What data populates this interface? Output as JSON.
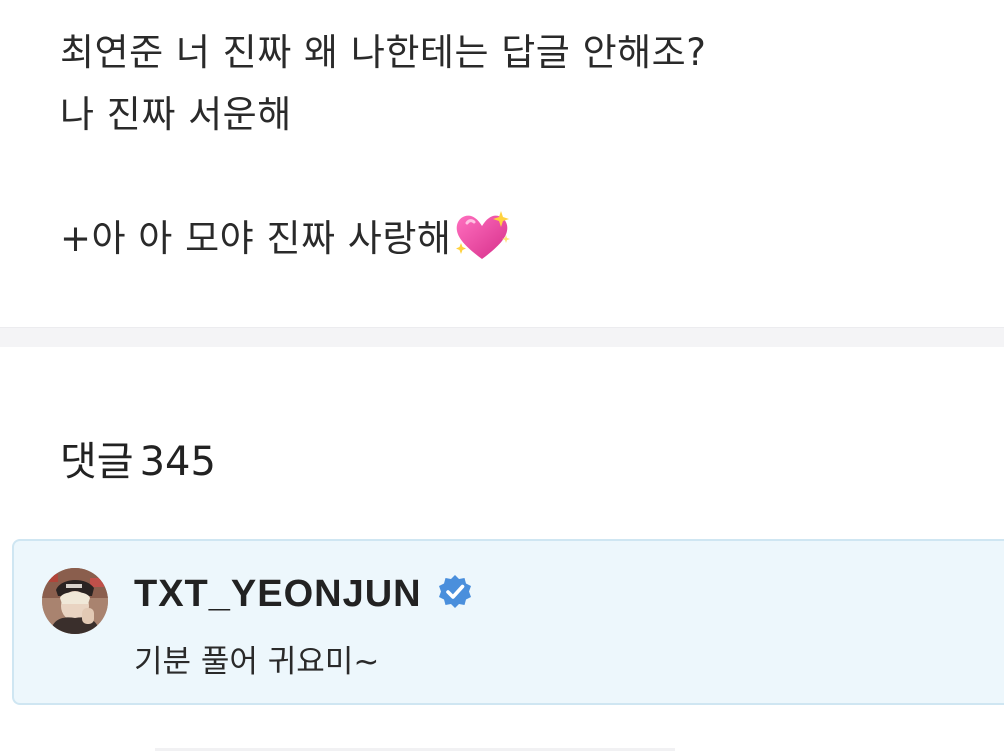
{
  "post": {
    "lines": [
      "최연준 너 진짜 왜 나한테는 답글 안해조?",
      "나 진짜 서운해",
      "",
      "+아 아 모야 진짜 사랑해"
    ],
    "emoji_icon": "sparkling-heart-icon"
  },
  "comments": {
    "label": "댓글",
    "count": "345"
  },
  "comment": {
    "author": "TXT_YEONJUN",
    "verified_icon": "verified-badge-icon",
    "text": "기분 풀어 귀요미~"
  },
  "colors": {
    "card_background": "#edf7fc",
    "card_border": "#cfe6f2",
    "verified_blue": "#4a8fdc",
    "heart_pink": "#e8479a"
  }
}
